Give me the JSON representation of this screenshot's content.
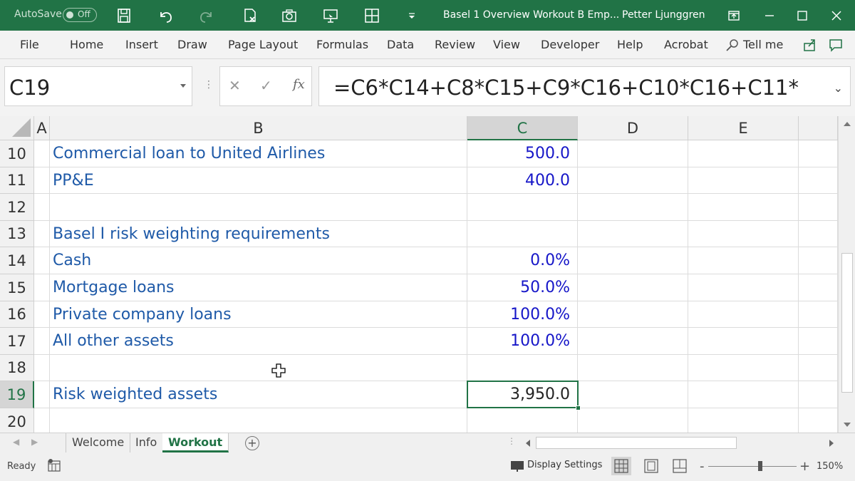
{
  "titlebar": {
    "autosave_label": "AutoSave",
    "autosave_state": "Off",
    "document_title": "Basel 1 Overview Workout B Emp...",
    "user_name": "Petter Ljunggren"
  },
  "ribbon": {
    "tabs": [
      "File",
      "Home",
      "Insert",
      "Draw",
      "Page Layout",
      "Formulas",
      "Data",
      "Review",
      "View",
      "Developer",
      "Help",
      "Acrobat",
      "Tell me"
    ]
  },
  "formula_bar": {
    "name_box": "C19",
    "formula": "=C6*C14+C8*C15+C9*C16+C10*C16+C11*",
    "fx_label": "fx"
  },
  "grid": {
    "columns": [
      "A",
      "B",
      "C",
      "D",
      "E"
    ],
    "selected_column": "C",
    "rows": [
      {
        "num": "10",
        "b": "Commercial loan to United Airlines",
        "c": "500.0"
      },
      {
        "num": "11",
        "b": "PP&E",
        "c": "400.0"
      },
      {
        "num": "12",
        "b": "",
        "c": ""
      },
      {
        "num": "13",
        "b": "Basel I risk weighting requirements",
        "c": ""
      },
      {
        "num": "14",
        "b": "Cash",
        "c": "0.0%"
      },
      {
        "num": "15",
        "b": "Mortgage loans",
        "c": "50.0%"
      },
      {
        "num": "16",
        "b": "Private company loans",
        "c": "100.0%"
      },
      {
        "num": "17",
        "b": "All other assets",
        "c": "100.0%"
      },
      {
        "num": "18",
        "b": "",
        "c": ""
      },
      {
        "num": "19",
        "b": "Risk weighted assets",
        "c": "3,950.0"
      },
      {
        "num": "20",
        "b": "",
        "c": ""
      }
    ],
    "active_row": "19"
  },
  "sheets": {
    "tabs": [
      "Welcome",
      "Info",
      "Workout"
    ],
    "active": "Workout"
  },
  "statusbar": {
    "status": "Ready",
    "display_settings": "Display Settings",
    "zoom": "150%"
  }
}
